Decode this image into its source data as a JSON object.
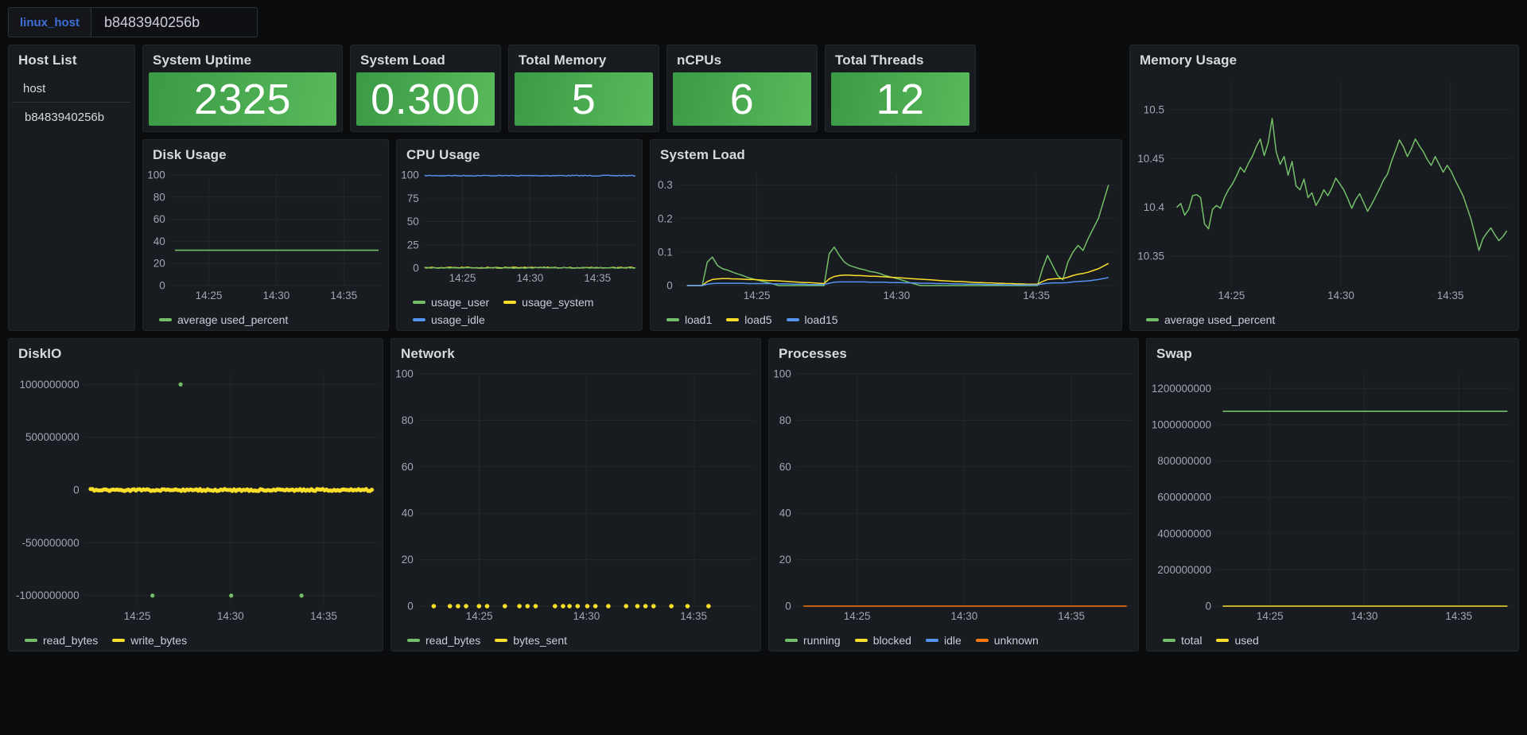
{
  "variables": {
    "name_label": "linux_host",
    "value": "b8483940256b"
  },
  "colors": {
    "green": "#73bf69",
    "yellow": "#fade2a",
    "blue": "#5794f2",
    "orange": "#ff780a",
    "stat_green_from": "#3a9a46",
    "stat_green_to": "#59ba5a",
    "panel_bg": "#181b1f",
    "page_bg": "#0b0c0e",
    "accent_blue": "#3d71d9"
  },
  "host_list": {
    "title": "Host List",
    "column": "host",
    "rows": [
      "b8483940256b"
    ]
  },
  "stats": [
    {
      "title": "System Uptime",
      "value": "2325"
    },
    {
      "title": "System Load",
      "value": "0.300"
    },
    {
      "title": "Total Memory",
      "value": "5"
    },
    {
      "title": "nCPUs",
      "value": "6"
    },
    {
      "title": "Total Threads",
      "value": "12"
    }
  ],
  "chart_data": [
    {
      "id": "memory_usage",
      "type": "line",
      "title": "Memory Usage",
      "xlabel": "",
      "ylabel": "",
      "x_ticks": [
        "14:25",
        "14:30",
        "14:35"
      ],
      "y_ticks": [
        "10.35",
        "10.4",
        "10.45",
        "10.5"
      ],
      "ylim": [
        10.32,
        10.53
      ],
      "grid": true,
      "legend": [
        {
          "name": "average used_percent",
          "color": "#73bf69"
        }
      ],
      "series": [
        {
          "name": "average used_percent",
          "color": "#73bf69",
          "values": [
            10.4,
            10.404,
            10.392,
            10.398,
            10.412,
            10.413,
            10.41,
            10.383,
            10.378,
            10.398,
            10.402,
            10.399,
            10.41,
            10.418,
            10.424,
            10.432,
            10.441,
            10.436,
            10.445,
            10.452,
            10.462,
            10.47,
            10.453,
            10.466,
            10.491,
            10.457,
            10.444,
            10.452,
            10.433,
            10.447,
            10.422,
            10.418,
            10.429,
            10.41,
            10.415,
            10.402,
            10.409,
            10.418,
            10.412,
            10.42,
            10.43,
            10.424,
            10.418,
            10.409,
            10.399,
            10.408,
            10.414,
            10.405,
            10.396,
            10.403,
            10.411,
            10.419,
            10.428,
            10.434,
            10.447,
            10.458,
            10.469,
            10.462,
            10.452,
            10.46,
            10.47,
            10.463,
            10.457,
            10.449,
            10.443,
            10.452,
            10.444,
            10.436,
            10.443,
            10.437,
            10.428,
            10.42,
            10.412,
            10.4,
            10.388,
            10.372,
            10.356,
            10.368,
            10.374,
            10.379,
            10.372,
            10.366,
            10.37,
            10.376
          ]
        }
      ]
    },
    {
      "id": "disk_usage",
      "type": "line",
      "title": "Disk Usage",
      "x_ticks": [
        "14:25",
        "14:30",
        "14:35"
      ],
      "y_ticks": [
        "0",
        "20",
        "40",
        "60",
        "80",
        "100"
      ],
      "ylim": [
        0,
        100
      ],
      "grid": true,
      "legend": [
        {
          "name": "average used_percent",
          "color": "#73bf69"
        }
      ],
      "series": [
        {
          "name": "average used_percent",
          "color": "#73bf69",
          "constant": 32
        }
      ]
    },
    {
      "id": "cpu_usage",
      "type": "line",
      "title": "CPU Usage",
      "x_ticks": [
        "14:25",
        "14:30",
        "14:35"
      ],
      "y_ticks": [
        "0",
        "25",
        "50",
        "75",
        "100"
      ],
      "ylim": [
        0,
        100
      ],
      "grid": true,
      "legend": [
        {
          "name": "usage_user",
          "color": "#73bf69"
        },
        {
          "name": "usage_system",
          "color": "#fade2a"
        },
        {
          "name": "usage_idle",
          "color": "#5794f2"
        }
      ],
      "series": [
        {
          "name": "usage_idle",
          "color": "#5794f2",
          "constant": 99.3
        },
        {
          "name": "usage_system",
          "color": "#fade2a",
          "constant": 0.5
        },
        {
          "name": "usage_user",
          "color": "#73bf69",
          "constant": 0.2
        }
      ]
    },
    {
      "id": "system_load",
      "type": "line",
      "title": "System Load",
      "x_ticks": [
        "14:25",
        "14:30",
        "14:35"
      ],
      "y_ticks": [
        "0",
        "0.1",
        "0.2",
        "0.3"
      ],
      "ylim": [
        0,
        0.33
      ],
      "grid": true,
      "legend": [
        {
          "name": "load1",
          "color": "#73bf69"
        },
        {
          "name": "load5",
          "color": "#fade2a"
        },
        {
          "name": "load15",
          "color": "#5794f2"
        }
      ],
      "series": [
        {
          "name": "load1",
          "color": "#73bf69",
          "values": [
            0.0,
            0.0,
            0.0,
            0.0,
            0.07,
            0.085,
            0.06,
            0.05,
            0.046,
            0.04,
            0.035,
            0.03,
            0.024,
            0.02,
            0.016,
            0.012,
            0.008,
            0.005,
            0.0,
            0.0,
            0.0,
            0.0,
            0.0,
            0.0,
            0.0,
            0.0,
            0.0,
            0.0,
            0.095,
            0.115,
            0.09,
            0.07,
            0.06,
            0.055,
            0.05,
            0.047,
            0.042,
            0.04,
            0.036,
            0.03,
            0.026,
            0.022,
            0.018,
            0.013,
            0.008,
            0.004,
            0.0,
            0.0,
            0.0,
            0.0,
            0.0,
            0.0,
            0.0,
            0.0,
            0.0,
            0.0,
            0.0,
            0.0,
            0.0,
            0.0,
            0.0,
            0.0,
            0.0,
            0.0,
            0.0,
            0.0,
            0.0,
            0.0,
            0.0,
            0.0,
            0.05,
            0.09,
            0.06,
            0.03,
            0.017,
            0.07,
            0.1,
            0.12,
            0.105,
            0.14,
            0.17,
            0.2,
            0.25,
            0.3
          ]
        },
        {
          "name": "load5",
          "color": "#fade2a",
          "values": [
            0.0,
            0.0,
            0.0,
            0.0,
            0.012,
            0.018,
            0.02,
            0.021,
            0.021,
            0.02,
            0.02,
            0.019,
            0.018,
            0.018,
            0.017,
            0.016,
            0.015,
            0.015,
            0.014,
            0.013,
            0.012,
            0.011,
            0.01,
            0.009,
            0.009,
            0.008,
            0.007,
            0.006,
            0.02,
            0.027,
            0.03,
            0.031,
            0.031,
            0.03,
            0.03,
            0.029,
            0.028,
            0.028,
            0.027,
            0.026,
            0.025,
            0.024,
            0.023,
            0.022,
            0.021,
            0.02,
            0.019,
            0.018,
            0.017,
            0.016,
            0.015,
            0.014,
            0.013,
            0.012,
            0.012,
            0.011,
            0.01,
            0.009,
            0.009,
            0.008,
            0.008,
            0.007,
            0.007,
            0.006,
            0.006,
            0.005,
            0.005,
            0.004,
            0.004,
            0.004,
            0.012,
            0.018,
            0.02,
            0.021,
            0.021,
            0.025,
            0.03,
            0.034,
            0.036,
            0.04,
            0.045,
            0.05,
            0.058,
            0.066
          ]
        },
        {
          "name": "load15",
          "color": "#5794f2",
          "values": [
            0.0,
            0.0,
            0.0,
            0.0,
            0.004,
            0.006,
            0.007,
            0.007,
            0.007,
            0.007,
            0.007,
            0.007,
            0.006,
            0.006,
            0.006,
            0.006,
            0.006,
            0.005,
            0.005,
            0.005,
            0.005,
            0.004,
            0.004,
            0.004,
            0.003,
            0.003,
            0.003,
            0.003,
            0.007,
            0.01,
            0.011,
            0.011,
            0.011,
            0.011,
            0.011,
            0.011,
            0.01,
            0.01,
            0.01,
            0.01,
            0.009,
            0.009,
            0.009,
            0.008,
            0.008,
            0.008,
            0.007,
            0.007,
            0.007,
            0.006,
            0.006,
            0.006,
            0.005,
            0.005,
            0.005,
            0.004,
            0.004,
            0.004,
            0.004,
            0.003,
            0.003,
            0.003,
            0.003,
            0.002,
            0.002,
            0.002,
            0.002,
            0.002,
            0.002,
            0.002,
            0.005,
            0.007,
            0.008,
            0.008,
            0.008,
            0.009,
            0.011,
            0.012,
            0.013,
            0.014,
            0.016,
            0.018,
            0.021,
            0.024
          ]
        }
      ]
    },
    {
      "id": "diskio",
      "type": "scatter",
      "title": "DiskIO",
      "x_ticks": [
        "14:25",
        "14:30",
        "14:35"
      ],
      "y_ticks": [
        "-1000000000",
        "-500000000",
        "0",
        "500000000",
        "1000000000"
      ],
      "ylim": [
        -1100000000,
        1100000000
      ],
      "grid": true,
      "legend": [
        {
          "name": "read_bytes",
          "color": "#73bf69"
        },
        {
          "name": "write_bytes",
          "color": "#fade2a"
        }
      ],
      "series": [
        {
          "name": "read_bytes",
          "color": "#73bf69",
          "points": [
            [
              0.32,
              1000000000
            ],
            [
              0.22,
              -1000000000
            ],
            [
              0.5,
              -1000000000
            ],
            [
              0.75,
              -1000000000
            ]
          ]
        },
        {
          "name": "write_bytes",
          "color": "#fade2a",
          "dense_zero_row": true
        }
      ]
    },
    {
      "id": "network",
      "type": "scatter",
      "title": "Network",
      "x_ticks": [
        "14:25",
        "14:30",
        "14:35"
      ],
      "y_ticks": [
        "0",
        "20",
        "40",
        "60",
        "80",
        "100"
      ],
      "ylim": [
        0,
        100
      ],
      "grid": true,
      "legend": [
        {
          "name": "read_bytes",
          "color": "#73bf69"
        },
        {
          "name": "bytes_sent",
          "color": "#fade2a"
        }
      ],
      "series": [
        {
          "name": "bytes_sent",
          "color": "#fade2a",
          "points_x": [
            0.025,
            0.075,
            0.1,
            0.125,
            0.165,
            0.19,
            0.245,
            0.29,
            0.315,
            0.34,
            0.4,
            0.425,
            0.445,
            0.47,
            0.5,
            0.525,
            0.565,
            0.62,
            0.655,
            0.68,
            0.705,
            0.76,
            0.81,
            0.875
          ],
          "y": 0
        }
      ]
    },
    {
      "id": "processes",
      "type": "line",
      "title": "Processes",
      "x_ticks": [
        "14:25",
        "14:30",
        "14:35"
      ],
      "y_ticks": [
        "0",
        "20",
        "40",
        "60",
        "80",
        "100"
      ],
      "ylim": [
        0,
        100
      ],
      "grid": true,
      "legend": [
        {
          "name": "running",
          "color": "#73bf69"
        },
        {
          "name": "blocked",
          "color": "#fade2a"
        },
        {
          "name": "idle",
          "color": "#5794f2"
        },
        {
          "name": "unknown",
          "color": "#ff780a"
        }
      ],
      "series": [
        {
          "name": "unknown",
          "color": "#ff780a",
          "constant": 0
        }
      ]
    },
    {
      "id": "swap",
      "type": "line",
      "title": "Swap",
      "x_ticks": [
        "14:25",
        "14:30",
        "14:35"
      ],
      "y_ticks": [
        "0",
        "200000000",
        "400000000",
        "600000000",
        "800000000",
        "1000000000",
        "1200000000"
      ],
      "ylim": [
        0,
        1280000000
      ],
      "grid": true,
      "legend": [
        {
          "name": "total",
          "color": "#73bf69"
        },
        {
          "name": "used",
          "color": "#fade2a"
        }
      ],
      "series": [
        {
          "name": "total",
          "color": "#73bf69",
          "constant": 1073741824
        },
        {
          "name": "used",
          "color": "#fade2a",
          "constant": 0
        }
      ]
    }
  ]
}
